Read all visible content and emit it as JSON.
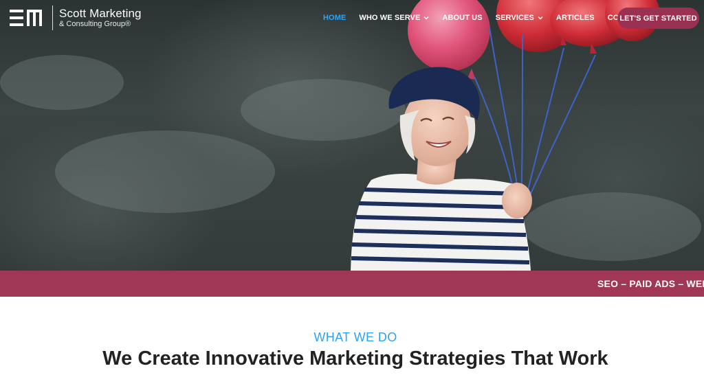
{
  "brand": {
    "name_line1": "Scott Marketing",
    "name_line2": "& Consulting Group®",
    "logo_icon": "scott-marketing-logo-icon",
    "color": "#ffffff"
  },
  "nav": {
    "items": [
      {
        "label": "HOME",
        "active": true,
        "has_dropdown": false
      },
      {
        "label": "WHO WE SERVE",
        "active": false,
        "has_dropdown": true
      },
      {
        "label": "ABOUT US",
        "active": false,
        "has_dropdown": false
      },
      {
        "label": "SERVICES",
        "active": false,
        "has_dropdown": true
      },
      {
        "label": "ARTICLES",
        "active": false,
        "has_dropdown": false
      },
      {
        "label": "CONTACT US",
        "active": false,
        "has_dropdown": false
      }
    ],
    "active_color": "#2ea3f2",
    "cta_label": "LET'S GET STARTED"
  },
  "ticker": {
    "text": "SEO – PAID ADS – WEBS",
    "background": "#a03755"
  },
  "section": {
    "label": "WHAT WE DO",
    "heading": "We Create Innovative Marketing Strategies That Work"
  },
  "colors": {
    "accent": "#2ea3f2",
    "brand": "#9b3152",
    "heading": "#222222"
  }
}
